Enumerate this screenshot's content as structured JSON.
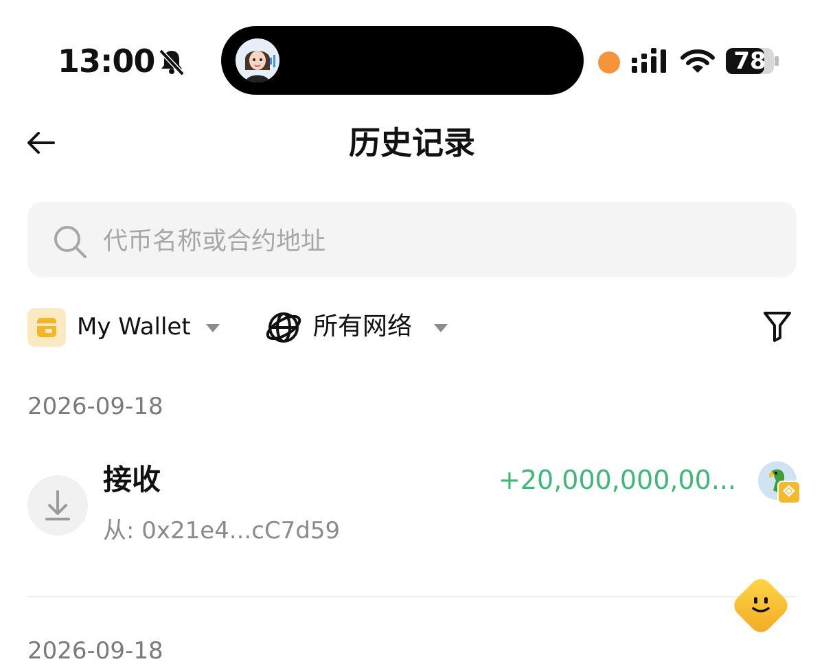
{
  "status_bar": {
    "time": "13:00",
    "battery": "78",
    "recording_dot_color": "#f5943b",
    "icons": [
      "bell-slash-icon",
      "signal-icon",
      "wifi-icon",
      "battery-icon"
    ]
  },
  "header": {
    "title": "历史记录",
    "back_icon": "arrow-left-icon"
  },
  "search": {
    "placeholder": "代币名称或合约地址",
    "value": ""
  },
  "filters": {
    "wallet_label": "My Wallet",
    "network_label": "所有网络",
    "filter_icon": "funnel-icon"
  },
  "transactions": [
    {
      "date": "2026-09-18",
      "type": "接收",
      "from": "从: 0x21e4...cC7d59",
      "amount": "+20,000,000,00...",
      "amount_color": "#3fb777",
      "icon": "download-icon"
    }
  ],
  "next_date": "2026-09-18",
  "colors": {
    "accent_green": "#3fb777",
    "search_bg": "#f4f4f4",
    "wallet_icon_bg": "#fbeac1",
    "assistant_yellow": "#f8c33a"
  }
}
